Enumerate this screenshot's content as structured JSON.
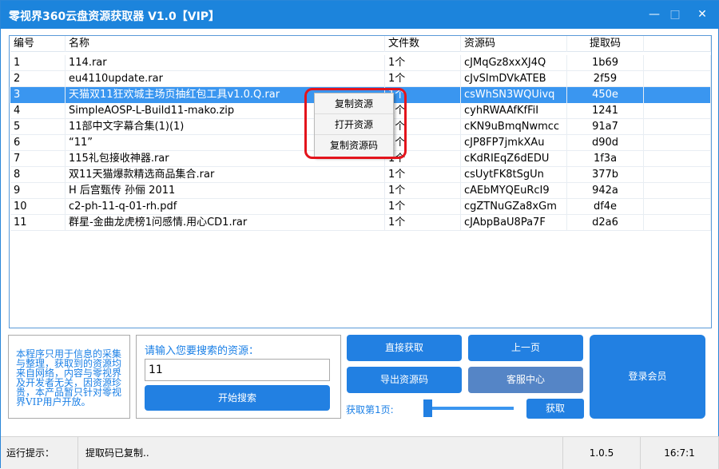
{
  "window": {
    "title": "零视界360云盘资源获取器 V1.0【VIP】",
    "min": "—",
    "max": "□",
    "close": "✕"
  },
  "table": {
    "headers": [
      "编号",
      "名称",
      "文件数",
      "资源码",
      "提取码"
    ],
    "rows": [
      [
        "1",
        "114.rar",
        "1个",
        "cJMqGz8xxXJ4Q",
        "1b69"
      ],
      [
        "2",
        "eu4110update.rar",
        "1个",
        "cJvSImDVkATEB",
        "2f59"
      ],
      [
        "3",
        "天猫双11狂欢城主场页抽红包工具v1.0.Q.rar",
        "1个",
        "csWhSN3WQUivq",
        "450e"
      ],
      [
        "4",
        "SimpleAOSP-L-Build11-mako.zip",
        "1个",
        "cyhRWAAfKfFiI",
        "1241"
      ],
      [
        "5",
        "11部中文字幕合集(1)(1)",
        "1个",
        "cKN9uBmqNwmcc",
        "91a7"
      ],
      [
        "6",
        "  “11”",
        "1个",
        "cJP8FP7jmkXAu",
        "d90d"
      ],
      [
        "7",
        "115礼包接收神器.rar",
        "1个",
        "cKdRIEqZ6dEDU",
        "1f3a"
      ],
      [
        "8",
        "双11天猫爆款精选商品集合.rar",
        "1个",
        "csUytFK8tSgUn",
        "377b"
      ],
      [
        "9",
        "H 后宫甄传 孙俪 2011",
        "1个",
        "cAEbMYQEuRcI9",
        "942a"
      ],
      [
        "10",
        "c2-ph-11-q-01-rh.pdf",
        "1个",
        "cgZTNuGZa8xGm",
        "df4e"
      ],
      [
        "11",
        "群星-金曲龙虎榜1问感情.用心CD1.rar",
        "1个",
        "cJAbpBaU8Pa7F",
        "d2a6"
      ]
    ],
    "selected_row": 3
  },
  "context_menu": [
    "复制资源",
    "打开资源",
    "复制资源码"
  ],
  "note": "本程序只用于信息的采集与整理，获取到的资源均来自网络，内容与零视界及开发者无关，因资源珍贵，本产品暂只针对零视界VIP用户开放。",
  "search": {
    "label": "请输入您要搜索的资源：",
    "value": "11",
    "button": "开始搜索"
  },
  "buttons": {
    "direct": "直接获取",
    "prev": "上一页",
    "export": "导出资源码",
    "service": "客服中心",
    "login": "登录会员",
    "fetch": "获取"
  },
  "page": {
    "label": "获取第1页:",
    "slider_value": 1
  },
  "status": {
    "label": "运行提示：",
    "message": "提取码已复制..",
    "version": "1.0.5",
    "time": "16:7:1"
  }
}
